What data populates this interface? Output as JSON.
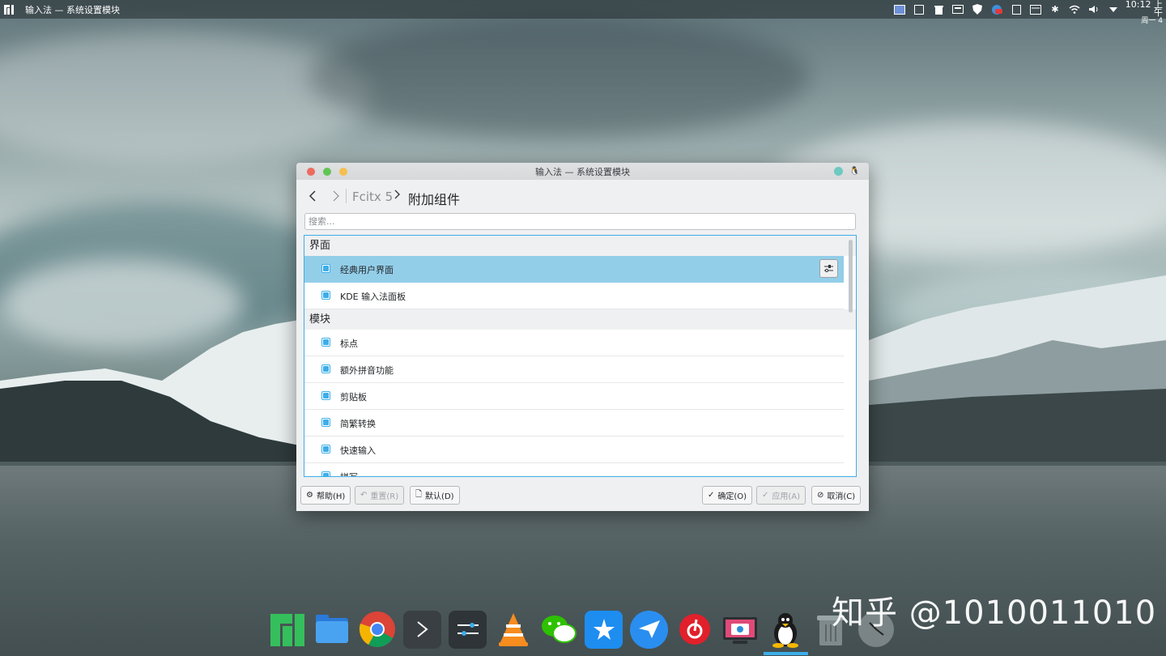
{
  "top_panel": {
    "window_title": "输入法 — 系统设置模块",
    "clock_time": "10:12 上午",
    "clock_day": "周一 4",
    "tray_icons": [
      "desktop-pager-icon",
      "window-icon",
      "trash-icon",
      "monitor-icon",
      "shield-icon",
      "mail-badge-icon",
      "clipboard-icon",
      "calendar-icon",
      "bluetooth-icon",
      "wifi-icon",
      "volume-icon",
      "tray-expand-icon"
    ]
  },
  "dialog": {
    "title": "输入法 — 系统设置模块",
    "breadcrumb": {
      "root": "Fcitx 5",
      "current": "附加组件"
    },
    "search_placeholder": "搜索...",
    "groups": [
      {
        "name": "界面",
        "items": [
          {
            "label": "经典用户界面",
            "selected": true,
            "has_config": true
          },
          {
            "label": "KDE 输入法面板",
            "selected": false
          }
        ]
      },
      {
        "name": "模块",
        "items": [
          {
            "label": "标点"
          },
          {
            "label": "额外拼音功能"
          },
          {
            "label": "剪贴板"
          },
          {
            "label": "简繁转换"
          },
          {
            "label": "快速输入"
          },
          {
            "label": "拼写"
          }
        ]
      }
    ],
    "buttons": {
      "help": "帮助(H)",
      "reset": "重置(R)",
      "defaults": "默认(D)",
      "ok": "确定(O)",
      "apply": "应用(A)",
      "cancel": "取消(C)"
    }
  },
  "dock": {
    "apps": [
      "manjaro-logo-icon",
      "file-manager-icon",
      "chrome-icon",
      "terminal-icon",
      "settings-sliders-icon",
      "vlc-icon",
      "wechat-icon",
      "dingtalk-icon",
      "feishu-icon",
      "netease-music-icon",
      "screenshot-icon",
      "tux-icon",
      "trash-icon",
      "clock-icon"
    ]
  },
  "watermark": "知乎 @1010011010",
  "colors": {
    "accent": "#3daee9",
    "selection": "#93cee9",
    "close": "#ed6a5e",
    "minimize": "#62c554",
    "maximize": "#f5bf4f"
  }
}
